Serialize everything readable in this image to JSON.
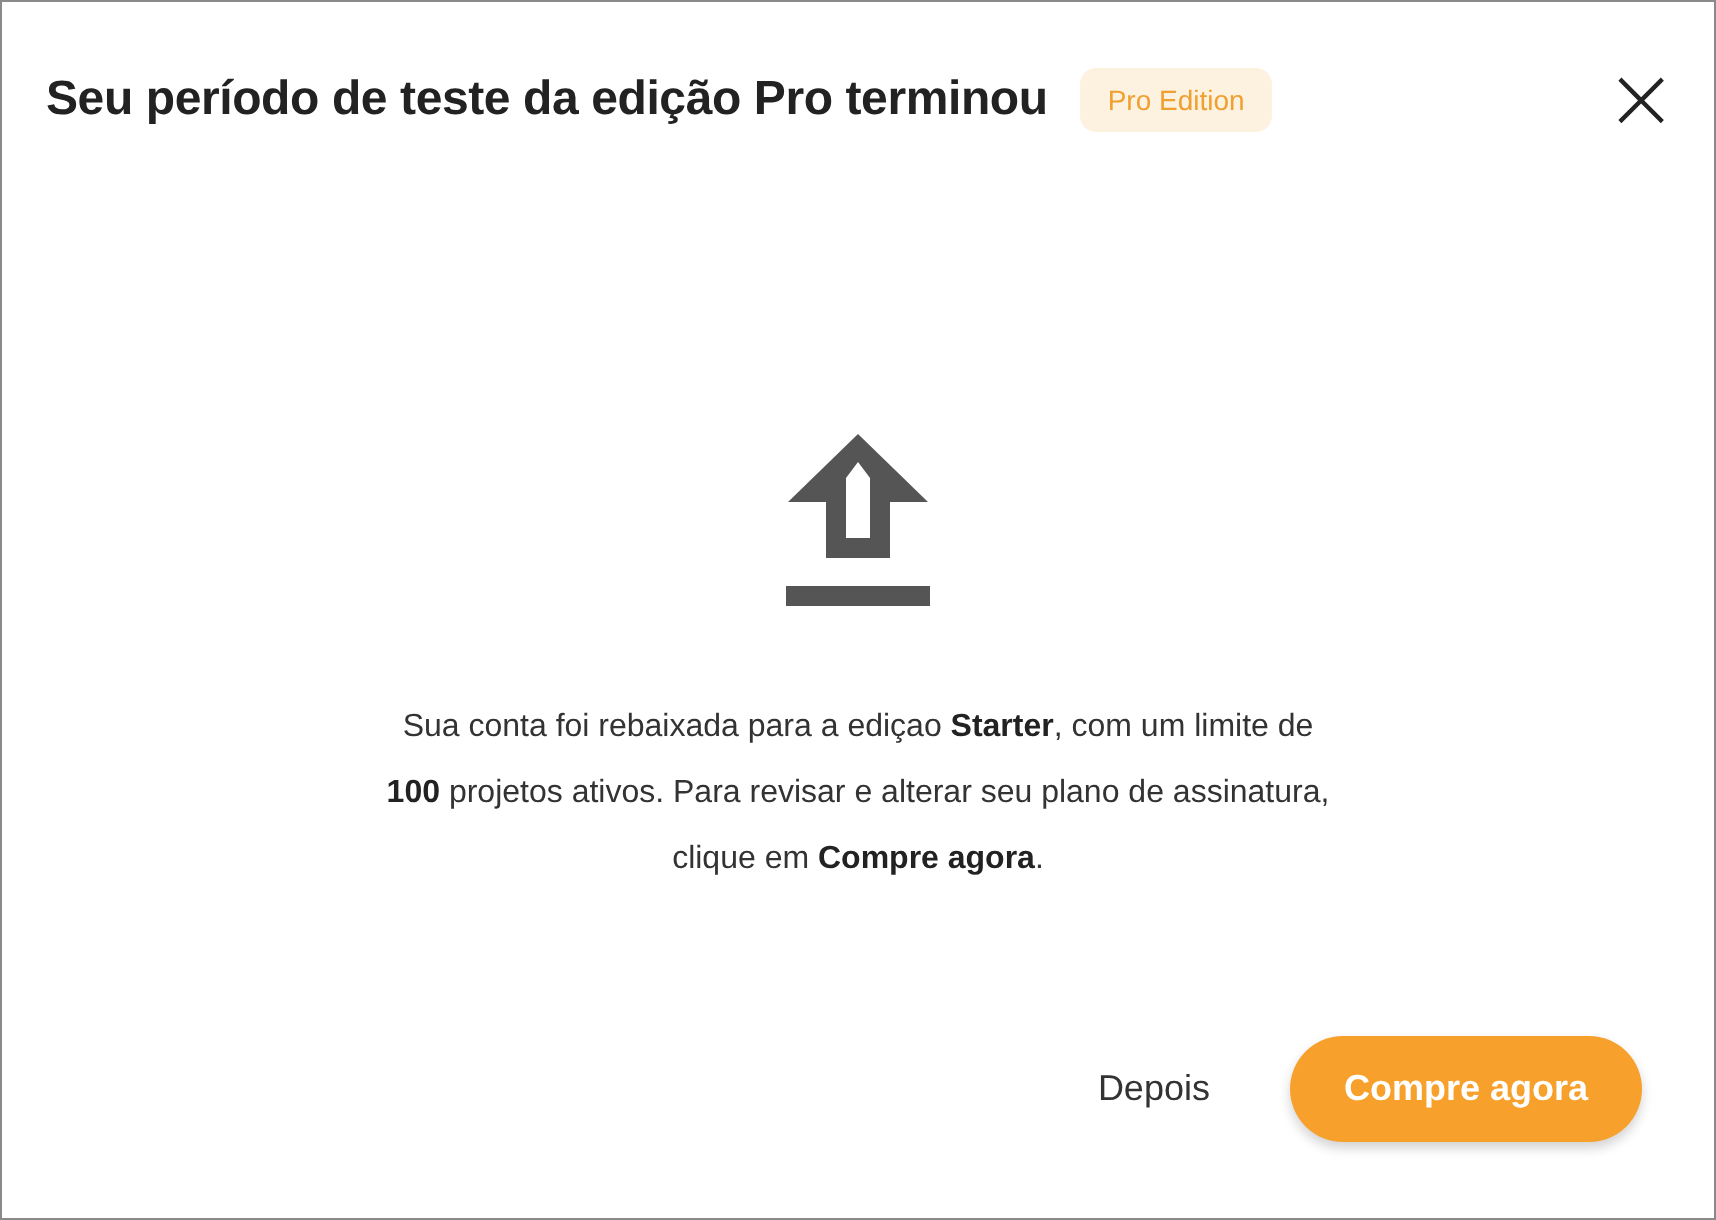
{
  "dialog": {
    "title": "Seu período de teste da edição Pro terminou",
    "badge": "Pro Edition",
    "close": "×",
    "message_lines": [
      "Sua conta foi rebaixada para a ediçao **Starter**, com um limite de",
      "**100** projetos ativos. Para revisar e alterar seu plano de assinatura,",
      "clique em **Compre agora**."
    ],
    "buttons": [
      {
        "kind": "text",
        "label": "Depois"
      },
      {
        "kind": "primary",
        "label": "Compre agora"
      }
    ]
  }
}
